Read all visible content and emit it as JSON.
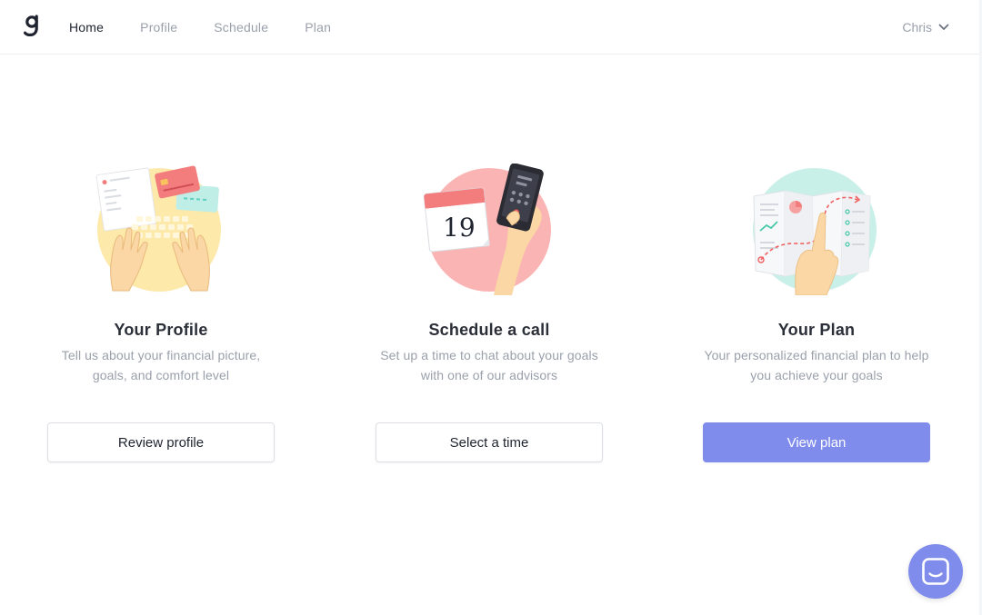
{
  "nav": {
    "logo_icon": "g-logo-icon",
    "links": [
      {
        "label": "Home",
        "active": true
      },
      {
        "label": "Profile",
        "active": false
      },
      {
        "label": "Schedule",
        "active": false
      },
      {
        "label": "Plan",
        "active": false
      }
    ],
    "user": {
      "name": "Chris",
      "icon": "chevron-down-icon"
    }
  },
  "cards": [
    {
      "illustration": "hands-typing-cards-illustration",
      "title": "Your Profile",
      "description": "Tell us about your financial picture, goals, and comfort level",
      "button": "Review profile"
    },
    {
      "illustration": "calendar-phone-illustration",
      "calendar_day": "19",
      "title": "Schedule a call",
      "description": "Set up a time to chat about your goals with one of our advisors",
      "button": "Select a time"
    },
    {
      "illustration": "plan-map-illustration",
      "title": "Your Plan",
      "description": "Your personalized financial plan to help you achieve your goals",
      "button": "View plan"
    }
  ],
  "chat": {
    "icon": "chat-icon"
  },
  "colors": {
    "accent": "#7f8ceb",
    "text": "#2b2f38",
    "muted": "#9aa0ab",
    "yellow": "#fde9a9",
    "pink": "#fbb4b4",
    "teal": "#c9efe9"
  }
}
